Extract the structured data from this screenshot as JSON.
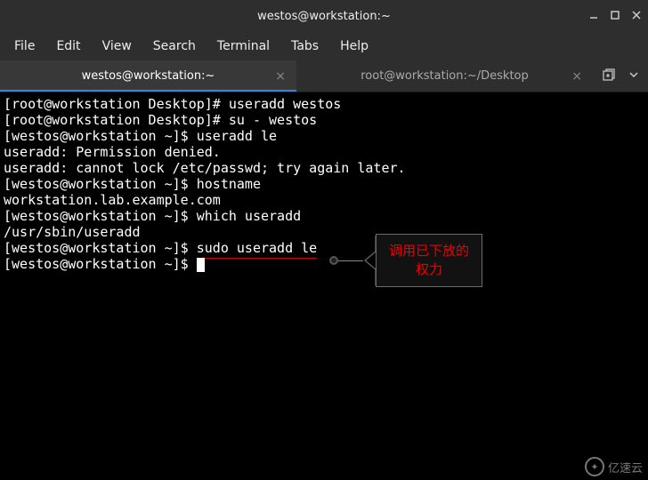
{
  "titlebar": {
    "title": "westos@workstation:~"
  },
  "menubar": {
    "items": [
      "File",
      "Edit",
      "View",
      "Search",
      "Terminal",
      "Tabs",
      "Help"
    ]
  },
  "tabs": {
    "items": [
      {
        "label": "westos@workstation:~",
        "active": true
      },
      {
        "label": "root@workstation:~/Desktop",
        "active": false
      }
    ]
  },
  "terminal": {
    "lines": [
      {
        "text": "[root@workstation Desktop]# useradd westos"
      },
      {
        "text": "[root@workstation Desktop]# su - westos"
      },
      {
        "text": "[westos@workstation ~]$ useradd le"
      },
      {
        "text": "useradd: Permission denied."
      },
      {
        "text": "useradd: cannot lock /etc/passwd; try again later."
      },
      {
        "text": "[westos@workstation ~]$ hostname"
      },
      {
        "text": "workstation.lab.example.com"
      },
      {
        "text": "[westos@workstation ~]$ which useradd"
      },
      {
        "text": "/usr/sbin/useradd"
      }
    ],
    "line10": {
      "prompt": "[westos@workstation ~]$ ",
      "command": "sudo useradd le"
    },
    "line11": {
      "prompt": "[westos@workstation ~]$ "
    }
  },
  "annotation": {
    "line1": "调用已下放的",
    "line2": "权力"
  },
  "watermark": {
    "text": "亿速云"
  }
}
